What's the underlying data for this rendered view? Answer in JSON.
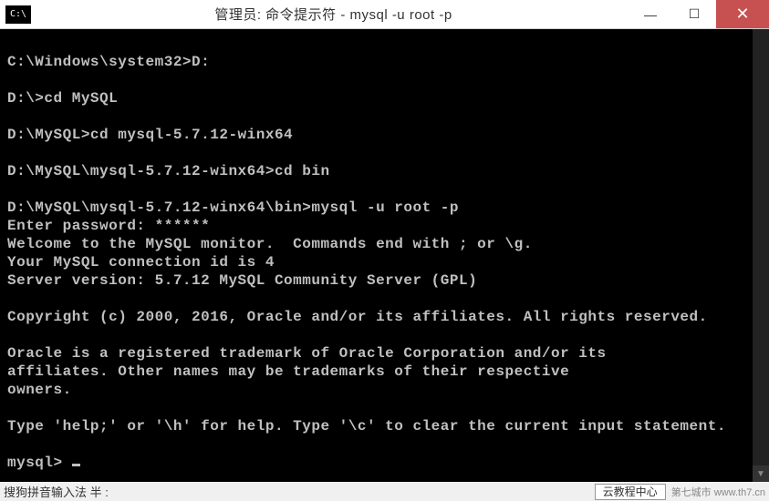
{
  "window": {
    "icon_label": "C:\\",
    "title": "管理员: 命令提示符 - mysql  -u root -p",
    "minimize": "—",
    "maximize": "☐",
    "close": "✕"
  },
  "terminal": {
    "lines": [
      "",
      "C:\\Windows\\system32>D:",
      "",
      "D:\\>cd MySQL",
      "",
      "D:\\MySQL>cd mysql-5.7.12-winx64",
      "",
      "D:\\MySQL\\mysql-5.7.12-winx64>cd bin",
      "",
      "D:\\MySQL\\mysql-5.7.12-winx64\\bin>mysql -u root -p",
      "Enter password: ******",
      "Welcome to the MySQL monitor.  Commands end with ; or \\g.",
      "Your MySQL connection id is 4",
      "Server version: 5.7.12 MySQL Community Server (GPL)",
      "",
      "Copyright (c) 2000, 2016, Oracle and/or its affiliates. All rights reserved.",
      "",
      "Oracle is a registered trademark of Oracle Corporation and/or its",
      "affiliates. Other names may be trademarks of their respective",
      "owners.",
      "",
      "Type 'help;' or '\\h' for help. Type '\\c' to clear the current input statement.",
      "",
      "mysql> "
    ]
  },
  "ime": {
    "left": "搜狗拼音输入法 半 :",
    "box": "云教程中心",
    "faint": "第七城市    www.th7.cn"
  }
}
